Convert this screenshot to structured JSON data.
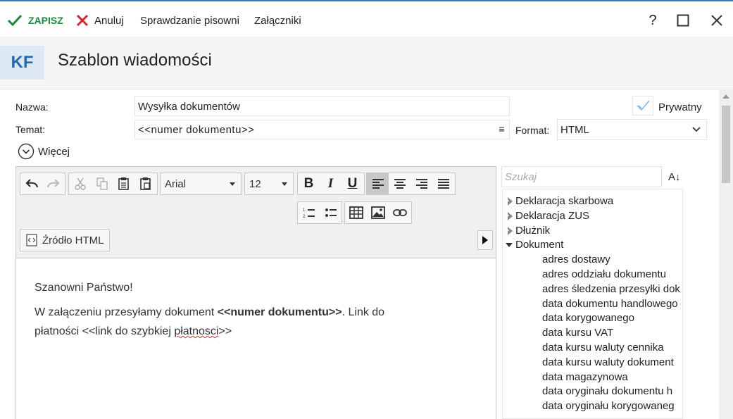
{
  "toolbar": {
    "save_label": "ZAPISZ",
    "cancel_label": "Anuluj",
    "spellcheck_label": "Sprawdzanie pisowni",
    "attachments_label": "Załączniki",
    "help_label": "?"
  },
  "header": {
    "badge": "KF",
    "title": "Szablon wiadomości"
  },
  "form": {
    "name_label": "Nazwa:",
    "name_value": "Wysyłka dokumentów",
    "private_label": "Prywatny",
    "private_checked": true,
    "subject_label": "Temat:",
    "subject_value": "<<numer dokumentu>>",
    "format_label": "Format:",
    "format_value": "HTML",
    "more_label": "Więcej"
  },
  "editor": {
    "font_value": "Arial",
    "size_value": "12",
    "source_label": "Źródło HTML",
    "greeting": "Szanowni Państwo!",
    "body_part1": "W załączeniu przesyłamy dokument ",
    "body_bold": "<<numer dokumentu>>",
    "body_part2": ". Link do",
    "body_line2_a": "płatności <<link do szybkiej ",
    "body_line2_spell": "płatnosci",
    "body_line2_b": ">>"
  },
  "fields_panel": {
    "search_placeholder": "Szukaj",
    "sort_label": "A↓",
    "groups": [
      {
        "label": "Deklaracja skarbowa",
        "expanded": false
      },
      {
        "label": "Deklaracja ZUS",
        "expanded": false
      },
      {
        "label": "Dłużnik",
        "expanded": false
      },
      {
        "label": "Dokument",
        "expanded": true
      }
    ],
    "items": [
      "adres dostawy",
      "adres oddziału dokumentu",
      "adres śledzenia przesyłki dok",
      "data dokumentu handlowego",
      "data korygowanego",
      "data kursu VAT",
      "data kursu waluty cennika",
      "data kursu waluty dokument",
      "data magazynowa",
      "data oryginału dokumentu h",
      "data oryginału korygowaneg"
    ]
  },
  "colors": {
    "accent": "#2b7cd3",
    "save_green": "#1a8a3a",
    "cancel_red": "#d9262c",
    "badge_bg": "#dde9f4",
    "badge_text": "#2468b0"
  }
}
